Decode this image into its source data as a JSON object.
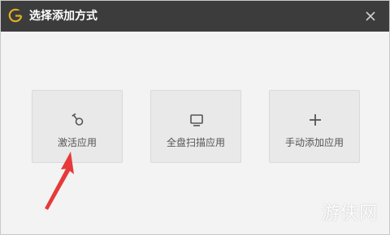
{
  "window": {
    "title": "选择添加方式",
    "icons": {
      "logo": "app-logo-icon",
      "close": "close-icon"
    },
    "accent_color": "#e0b020"
  },
  "options": [
    {
      "label": "激活应用",
      "icon": "activate-icon"
    },
    {
      "label": "全盘扫描应用",
      "icon": "monitor-icon"
    },
    {
      "label": "手动添加应用",
      "icon": "plus-icon"
    }
  ],
  "annotation": {
    "arrow_color": "#e63a3a"
  },
  "watermark": {
    "text": "游侠网"
  }
}
